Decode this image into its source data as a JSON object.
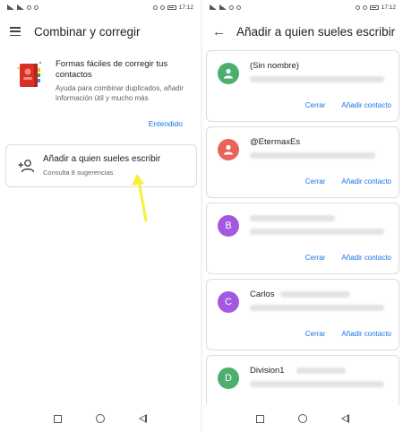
{
  "status_bar": {
    "time": "17:12"
  },
  "left": {
    "app_title": "Combinar y corregir",
    "tip": {
      "title": "Formas fáciles de corregir tus contactos",
      "description": "Ayuda para combinar duplicados, añadir información útil y mucho más",
      "action_label": "Entendido"
    },
    "add_card": {
      "title": "Añadir a quien sueles escribir",
      "subtitle": "Consulta 8 sugerencias"
    }
  },
  "right": {
    "app_title": "Añadir a quien sueles escribir",
    "contacts": [
      {
        "name": "(Sin nombre)",
        "avatar_letter": "",
        "avatar_color": "#4caf6e",
        "close_label": "Cerrar",
        "add_label": "Añadir contacto"
      },
      {
        "name": "@EtermaxEs",
        "avatar_letter": "",
        "avatar_color": "#e8645a",
        "close_label": "Cerrar",
        "add_label": "Añadir contacto"
      },
      {
        "name": "",
        "avatar_letter": "B",
        "avatar_color": "#a259e0",
        "close_label": "Cerrar",
        "add_label": "Añadir contacto"
      },
      {
        "name": "Carlos",
        "avatar_letter": "C",
        "avatar_color": "#a259e0",
        "close_label": "Cerrar",
        "add_label": "Añadir contacto"
      },
      {
        "name": "Division1",
        "avatar_letter": "D",
        "avatar_color": "#4caf6e",
        "close_label": "",
        "add_label": ""
      }
    ]
  },
  "colors": {
    "accent": "#1a73e8",
    "arrow": "#f5f03a"
  }
}
